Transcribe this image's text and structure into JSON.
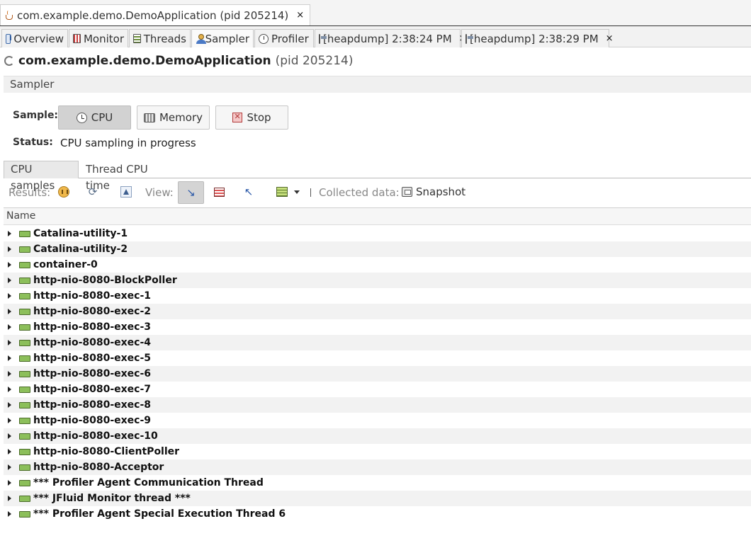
{
  "window": {
    "tab_title": "com.example.demo.DemoApplication (pid 205214)",
    "close_glyph": "×"
  },
  "tabs": [
    {
      "label": "Overview",
      "icon": "overview-icon"
    },
    {
      "label": "Monitor",
      "icon": "monitor-icon"
    },
    {
      "label": "Threads",
      "icon": "threads-icon"
    },
    {
      "label": "Sampler",
      "icon": "sampler-icon",
      "active": true
    },
    {
      "label": "Profiler",
      "icon": "profiler-icon"
    },
    {
      "label": "[heapdump] 2:38:24 PM",
      "icon": "heapdump-icon",
      "closable": true
    },
    {
      "label": "[heapdump] 2:38:29 PM",
      "icon": "heapdump-icon",
      "closable": true
    }
  ],
  "app": {
    "title": "com.example.demo.DemoApplication",
    "pid": "(pid 205214)"
  },
  "sampler": {
    "section": "Sampler",
    "sample_label": "Sample:",
    "buttons": {
      "cpu": "CPU",
      "memory": "Memory",
      "stop": "Stop"
    },
    "status_label": "Status:",
    "status_text": "CPU sampling in progress"
  },
  "subtabs": [
    {
      "label": "CPU samples",
      "active": true
    },
    {
      "label": "Thread CPU time"
    }
  ],
  "toolbar": {
    "results_label": "Results:",
    "view_label": "View:",
    "collected_label": "Collected data:",
    "snapshot_label": "Snapshot"
  },
  "table": {
    "column_name": "Name",
    "rows": [
      "Catalina-utility-1",
      "Catalina-utility-2",
      "container-0",
      "http-nio-8080-BlockPoller",
      "http-nio-8080-exec-1",
      "http-nio-8080-exec-2",
      "http-nio-8080-exec-3",
      "http-nio-8080-exec-4",
      "http-nio-8080-exec-5",
      "http-nio-8080-exec-6",
      "http-nio-8080-exec-7",
      "http-nio-8080-exec-8",
      "http-nio-8080-exec-9",
      "http-nio-8080-exec-10",
      "http-nio-8080-ClientPoller",
      "http-nio-8080-Acceptor",
      "*** Profiler Agent Communication Thread",
      "*** JFluid Monitor thread ***",
      "*** Profiler Agent Special Execution Thread 6"
    ]
  },
  "colors": {
    "thread_running": "#8cbf5a",
    "pressed": "#d2d2d2"
  }
}
